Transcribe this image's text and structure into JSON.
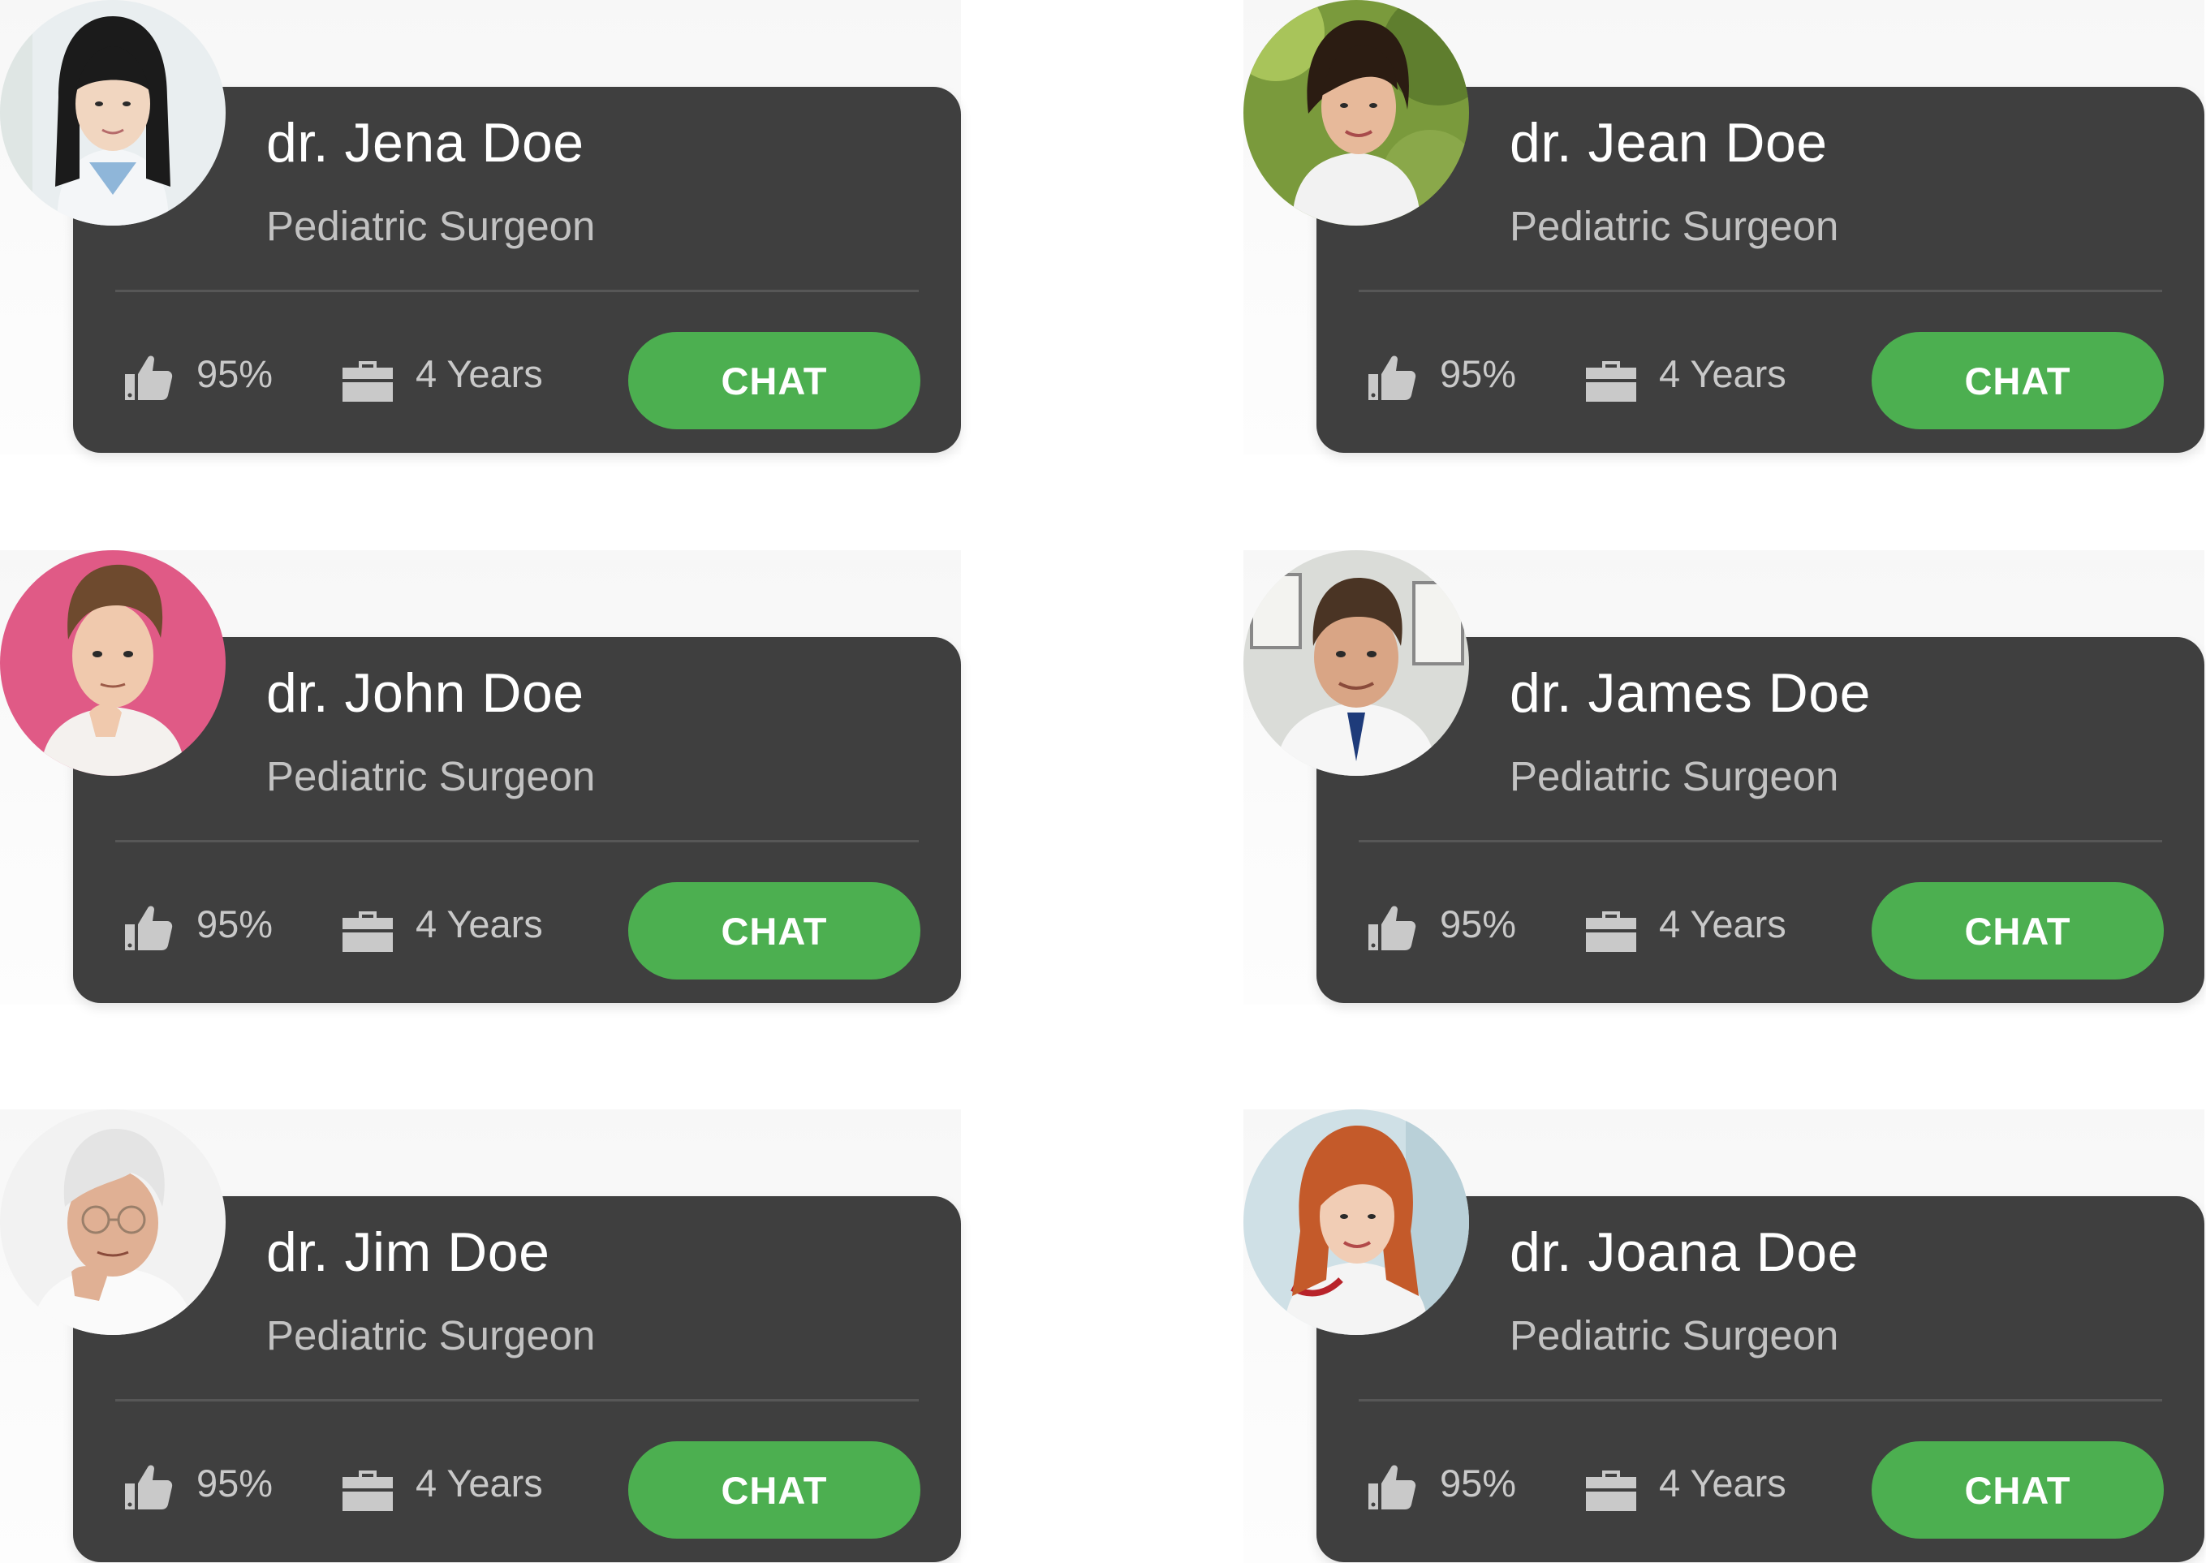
{
  "colors": {
    "card_background": "#3f3f3f",
    "chat_button": "#4caf50",
    "name_text": "#ffffff",
    "secondary_text": "#c2c2c2"
  },
  "icons": {
    "rating": "thumbs-up-icon",
    "experience": "briefcase-icon"
  },
  "doctors": [
    {
      "name": "dr. Jena Doe",
      "specialty": "Pediatric Surgeon",
      "rating": "95%",
      "experience": "4 Years",
      "chat_label": "CHAT"
    },
    {
      "name": "dr. Jean Doe",
      "specialty": "Pediatric Surgeon",
      "rating": "95%",
      "experience": "4 Years",
      "chat_label": "CHAT"
    },
    {
      "name": "dr. John Doe",
      "specialty": "Pediatric Surgeon",
      "rating": "95%",
      "experience": "4 Years",
      "chat_label": "CHAT"
    },
    {
      "name": "dr. James Doe",
      "specialty": "Pediatric Surgeon",
      "rating": "95%",
      "experience": "4 Years",
      "chat_label": "CHAT"
    },
    {
      "name": "dr. Jim Doe",
      "specialty": "Pediatric Surgeon",
      "rating": "95%",
      "experience": "4 Years",
      "chat_label": "CHAT"
    },
    {
      "name": "dr. Joana Doe",
      "specialty": "Pediatric Surgeon",
      "rating": "95%",
      "experience": "4 Years",
      "chat_label": "CHAT"
    }
  ]
}
